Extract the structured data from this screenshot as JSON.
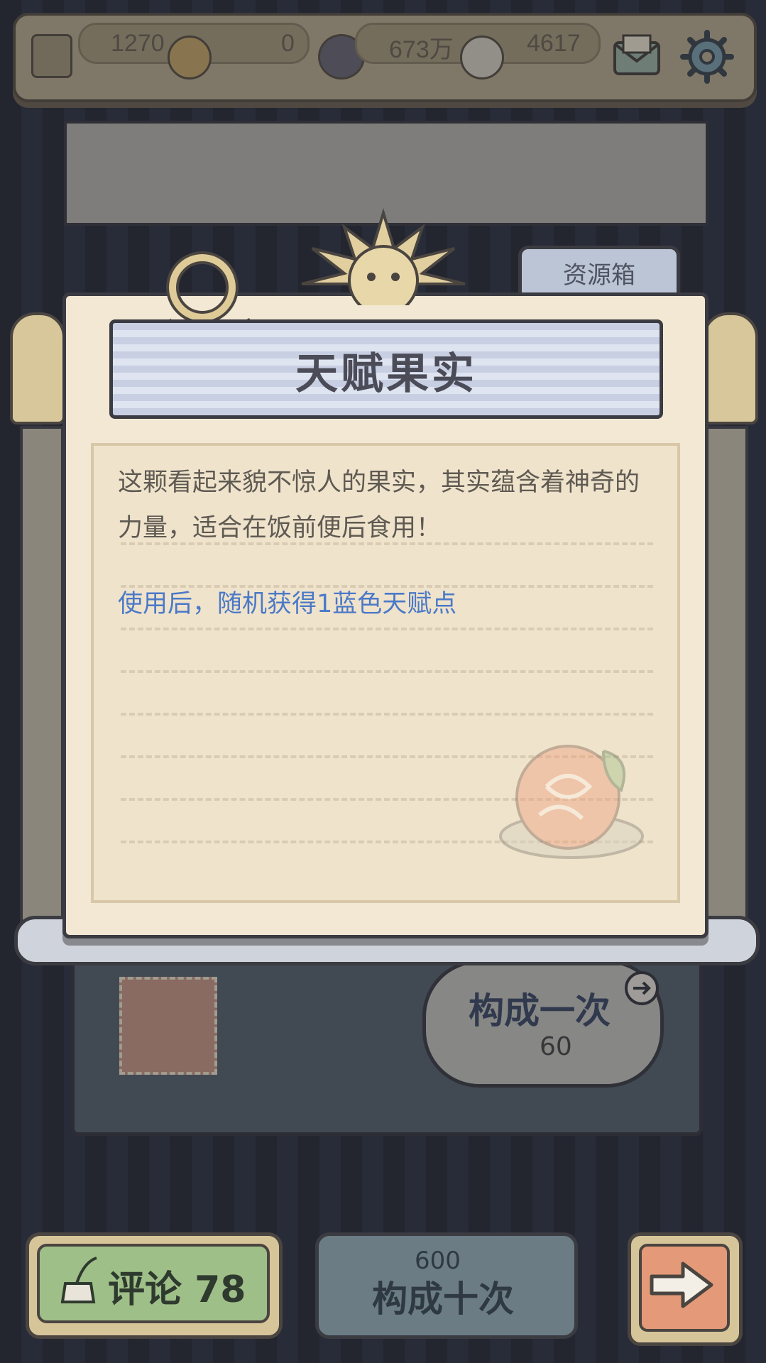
{
  "resources": {
    "item1_value": "1270",
    "item2_value": "0",
    "item3_value": "673万",
    "item4_value": "4617"
  },
  "modal": {
    "tab_label": "资源箱",
    "title": "天赋果实",
    "description": "这颗看起来貌不惊人的果实，其实蕴含着神奇的力量，适合在饭前便后食用！",
    "effect": "使用后，随机获得1蓝色天赋点"
  },
  "machine": {
    "build_once_label": "构成一次",
    "build_once_cost": "60"
  },
  "bottom": {
    "comment_label": "评论 78",
    "build_ten_label": "构成十次",
    "build_ten_cost": "600"
  },
  "colors": {
    "effect_text": "#4b79c7",
    "modal_bg": "#f3e8d4",
    "comment_button": "#9fbf88",
    "next_button": "#e49a78"
  }
}
